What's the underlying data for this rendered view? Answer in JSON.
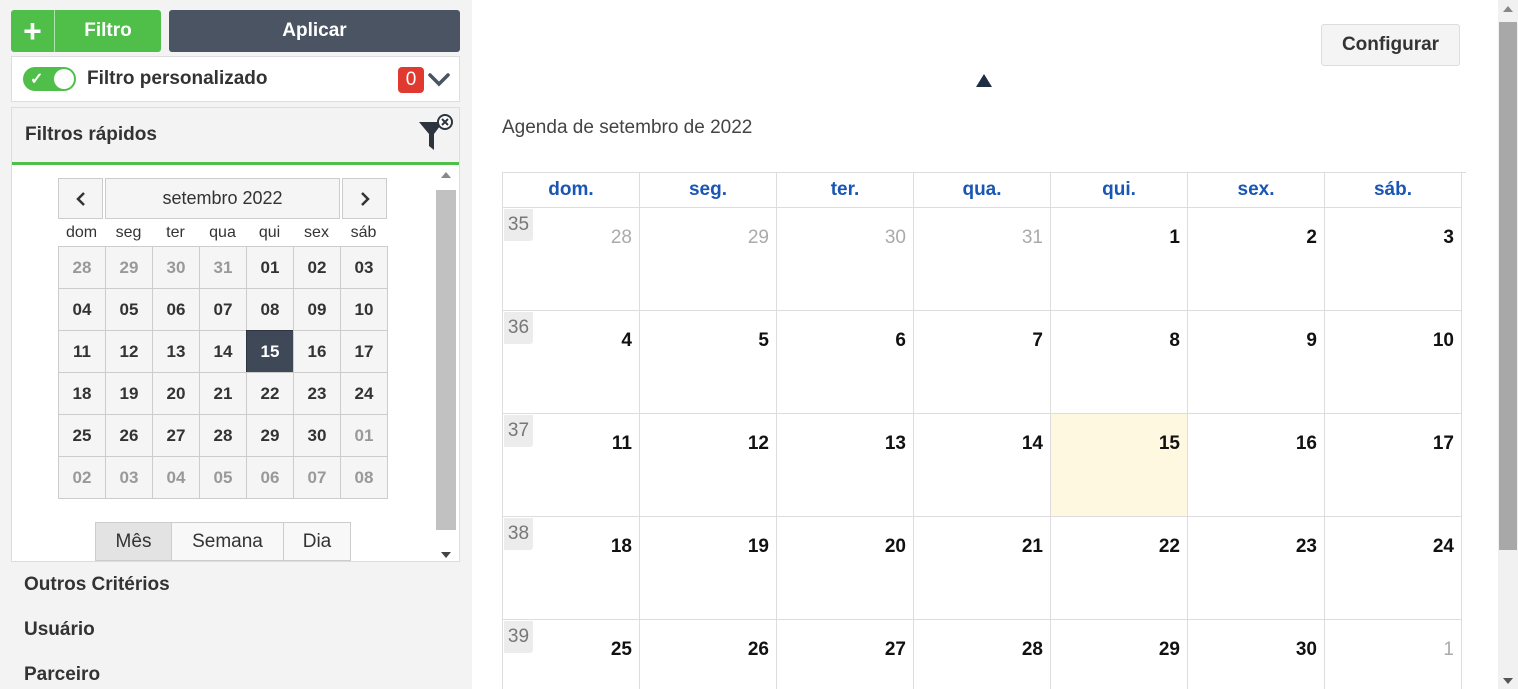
{
  "toolbar": {
    "filtro_label": "Filtro",
    "aplicar_label": "Aplicar",
    "plus_glyph": "+"
  },
  "filtro_personalizado": {
    "label": "Filtro personalizado",
    "count": "0",
    "toggle_on": true
  },
  "filtros_rapidos": {
    "title": "Filtros rápidos"
  },
  "datepicker": {
    "month_label": "setembro 2022",
    "weekdays": [
      "dom",
      "seg",
      "ter",
      "qua",
      "qui",
      "sex",
      "sáb"
    ],
    "days": [
      [
        "28",
        "29",
        "30",
        "31",
        "01",
        "02",
        "03"
      ],
      [
        "04",
        "05",
        "06",
        "07",
        "08",
        "09",
        "10"
      ],
      [
        "11",
        "12",
        "13",
        "14",
        "15",
        "16",
        "17"
      ],
      [
        "18",
        "19",
        "20",
        "21",
        "22",
        "23",
        "24"
      ],
      [
        "25",
        "26",
        "27",
        "28",
        "29",
        "30",
        "01"
      ],
      [
        "02",
        "03",
        "04",
        "05",
        "06",
        "07",
        "08"
      ]
    ],
    "selected": "15",
    "views": [
      "Mês",
      "Semana",
      "Dia"
    ],
    "active_view": "Mês"
  },
  "accordion": [
    "Outros Critérios",
    "Usuário",
    "Parceiro"
  ],
  "config_label": "Configurar",
  "agenda_title": "Agenda de setembro de 2022",
  "calendar": {
    "weekdays": [
      "dom.",
      "seg.",
      "ter.",
      "qua.",
      "qui.",
      "sex.",
      "sáb."
    ],
    "weeks": [
      {
        "num": "35",
        "days": [
          "28",
          "29",
          "30",
          "31",
          "1",
          "2",
          "3"
        ]
      },
      {
        "num": "36",
        "days": [
          "4",
          "5",
          "6",
          "7",
          "8",
          "9",
          "10"
        ]
      },
      {
        "num": "37",
        "days": [
          "11",
          "12",
          "13",
          "14",
          "15",
          "16",
          "17"
        ]
      },
      {
        "num": "38",
        "days": [
          "18",
          "19",
          "20",
          "21",
          "22",
          "23",
          "24"
        ]
      },
      {
        "num": "39",
        "days": [
          "25",
          "26",
          "27",
          "28",
          "29",
          "30",
          "1"
        ]
      }
    ],
    "today": "15"
  },
  "colors": {
    "green": "#4fbf4a",
    "dark": "#4a5462",
    "red": "#e0392f",
    "blue": "#1a56b3",
    "today_bg": "#fef8e0"
  }
}
